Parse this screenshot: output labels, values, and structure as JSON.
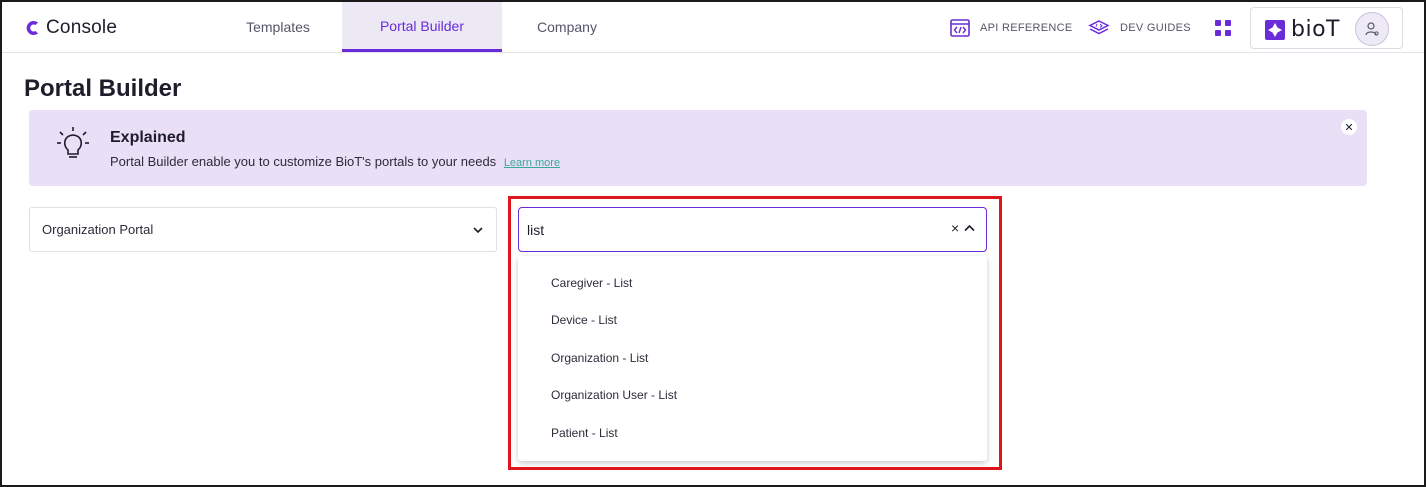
{
  "app": {
    "name": "Console"
  },
  "nav": {
    "tabs": [
      {
        "label": "Templates"
      },
      {
        "label": "Portal Builder",
        "active": true
      },
      {
        "label": "Company"
      }
    ],
    "links": {
      "api_reference": "API REFERENCE",
      "dev_guides": "DEV GUIDES"
    },
    "brand": "bioT"
  },
  "page": {
    "title": "Portal Builder"
  },
  "banner": {
    "title": "Explained",
    "text": "Portal Builder enable you to customize BioT's portals to your needs",
    "link": "Learn more"
  },
  "portal_select": {
    "value": "Organization Portal"
  },
  "search": {
    "value": "list",
    "clear_symbol": "×"
  },
  "dropdown": {
    "items": [
      "Caregiver - List",
      "Device - List",
      "Organization - List",
      "Organization User - List",
      "Patient - List"
    ]
  },
  "colors": {
    "accent": "#6a2bd9",
    "banner_bg": "#e9dff7",
    "link": "#3aa896",
    "highlight": "#e0141c"
  }
}
